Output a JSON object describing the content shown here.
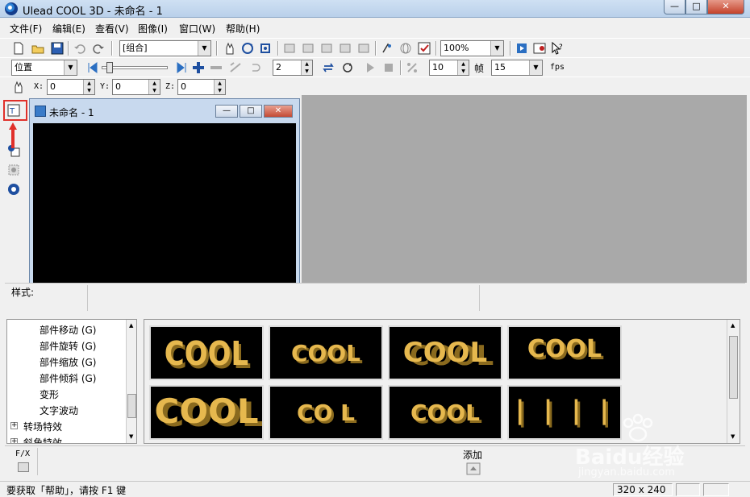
{
  "window": {
    "title": "Ulead COOL 3D - 未命名 - 1"
  },
  "menu": [
    "文件(F)",
    "编辑(E)",
    "查看(V)",
    "图像(I)",
    "窗口(W)",
    "帮助(H)"
  ],
  "toolbar1": {
    "object_select": "[组合]",
    "zoom": "100%"
  },
  "toolbar2": {
    "attribute_select": "位置",
    "frame_value": "2",
    "total_frames": "10",
    "frames_label": "帧",
    "fps_value": "15",
    "fps_label": "fps"
  },
  "toolbar3": {
    "x_label": "X:",
    "x_value": "0",
    "y_label": "Y:",
    "y_value": "0",
    "z_label": "Z:",
    "z_value": "0"
  },
  "document": {
    "title": "未命名 - 1"
  },
  "style_pane": {
    "label": "样式:"
  },
  "tree": {
    "items": [
      "部件移动 (G)",
      "部件旋转 (G)",
      "部件缩放 (G)",
      "部件倾斜 (G)",
      "变形",
      "文字波动"
    ],
    "roots": [
      "转场特效",
      "斜角特效"
    ]
  },
  "thumbnails": [
    "COOL",
    "COOL",
    "COOL",
    "COOL",
    "COOL",
    "CO L",
    "COOL",
    "| | | |"
  ],
  "fx_bar": {
    "fx_label": "F/X",
    "add_label": "添加"
  },
  "status": {
    "help_text": "要获取「帮助」，请按 F1 键",
    "resolution": "320 x 240"
  },
  "watermark": {
    "brand": "Baidu经验",
    "url": "jingyan.baidu.com"
  }
}
